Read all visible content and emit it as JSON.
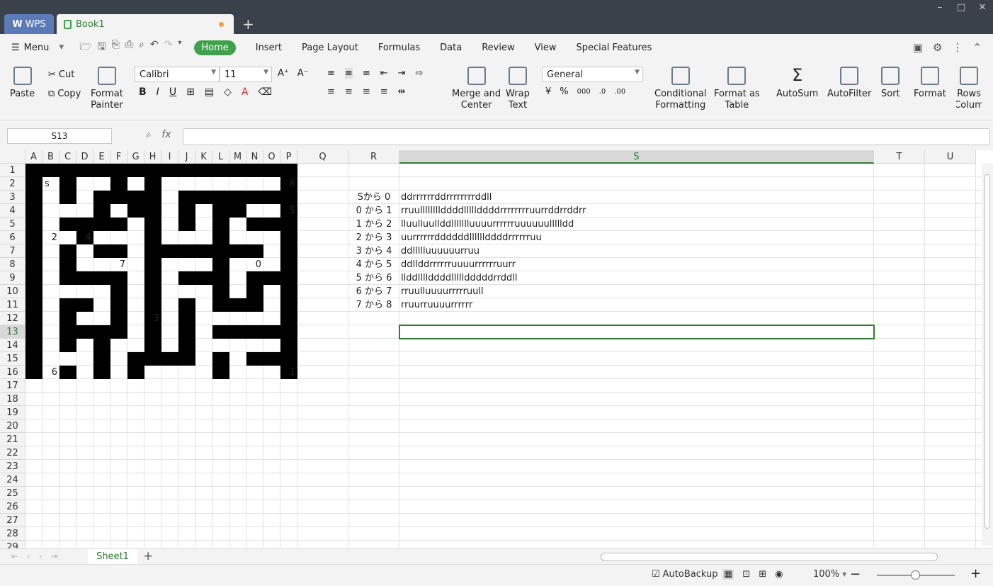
{
  "window": {
    "app_tab": "WPS",
    "doc_tab": "Book1",
    "new_tab": "+",
    "controls": [
      "–",
      "□",
      "✕"
    ]
  },
  "menubar": {
    "menu_label": "Menu",
    "tabs": [
      "Home",
      "Insert",
      "Page Layout",
      "Formulas",
      "Data",
      "Review",
      "View",
      "Special Features"
    ]
  },
  "ribbon": {
    "paste": "Paste",
    "cut": "Cut",
    "copy": "Copy",
    "format_painter_1": "Format",
    "format_painter_2": "Painter",
    "font_name": "Calibri",
    "font_size": "11",
    "merge_1": "Merge and",
    "merge_2": "Center",
    "wrap_1": "Wrap",
    "wrap_2": "Text",
    "number_format": "General",
    "cond_1": "Conditional",
    "cond_2": "Formatting",
    "fmt_table_1": "Format as",
    "fmt_table_2": "Table",
    "autosum": "AutoSum",
    "autofilter": "AutoFilter",
    "sort": "Sort",
    "format": "Format",
    "rows_1": "Rows",
    "rows_2": "Colum"
  },
  "formula_bar": {
    "name_box": "S13",
    "fx": "fx",
    "value": ""
  },
  "columns": [
    "A",
    "B",
    "C",
    "D",
    "E",
    "F",
    "G",
    "H",
    "I",
    "J",
    "K",
    "L",
    "M",
    "N",
    "O",
    "P",
    "Q",
    "R",
    "S",
    "T",
    "U"
  ],
  "selected_column": "S",
  "rows": [
    "1",
    "2",
    "3",
    "4",
    "5",
    "6",
    "7",
    "8",
    "9",
    "10",
    "11",
    "12",
    "13",
    "14",
    "15",
    "16",
    "17",
    "18",
    "19",
    "20",
    "21",
    "22",
    "23",
    "24",
    "25",
    "26",
    "27",
    "28",
    "29"
  ],
  "selected_row": "13",
  "maze": {
    "labels": [
      {
        "cell": "B2",
        "text": "s"
      },
      {
        "cell": "P2",
        "text": "8"
      },
      {
        "cell": "P4",
        "text": "5"
      },
      {
        "cell": "B6",
        "text": "2"
      },
      {
        "cell": "D6",
        "text": "4"
      },
      {
        "cell": "F8",
        "text": "7"
      },
      {
        "cell": "N8",
        "text": "0"
      },
      {
        "cell": "H12",
        "text": "3"
      },
      {
        "cell": "B16",
        "text": "6"
      },
      {
        "cell": "P16",
        "text": "1"
      }
    ]
  },
  "routes": [
    {
      "label": "Sから 0",
      "path": "ddrrrrrrddrrrrrrrrddll"
    },
    {
      "label": "0 から 1",
      "path": "rruullllllllddddlllllddddrrrrrrrruurrddrrddrr"
    },
    {
      "label": "1 から 2",
      "path": "lluulluullddllllllluuuurrrrrruuuuuullllldd"
    },
    {
      "label": "2 から 3",
      "path": "uurrrrrrddddddllllllddddrrrrrruu"
    },
    {
      "label": "3 から 4",
      "path": "ddllllluuuuuurruu"
    },
    {
      "label": "4 から 5",
      "path": "ddllddrrrrrruuuurrrrrruurr"
    },
    {
      "label": "5 から 6",
      "path": "llddllllddddllllldddddrrddll"
    },
    {
      "label": "6 から 7",
      "path": "rruulluuuurrrrruull"
    },
    {
      "label": "7 から 8",
      "path": "rruurruuuurrrrrr"
    }
  ],
  "sheet_tab": "Sheet1",
  "status": {
    "autobackup": "AutoBackup",
    "zoom": "100%"
  }
}
